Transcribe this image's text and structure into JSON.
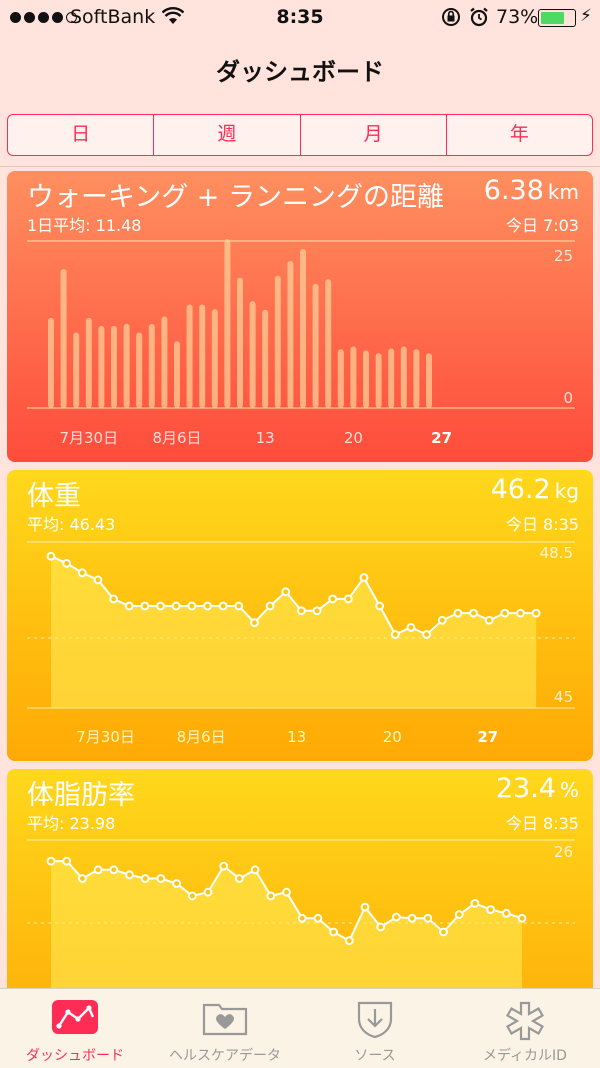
{
  "status_bar": {
    "carrier": "SoftBank",
    "time": "8:35",
    "battery_pct": "73%",
    "battery_level": 0.73
  },
  "nav": {
    "title": "ダッシュボード"
  },
  "segments": [
    {
      "label": "日",
      "active": false
    },
    {
      "label": "週",
      "active": false
    },
    {
      "label": "月",
      "active": true
    },
    {
      "label": "年",
      "active": false
    }
  ],
  "cards": {
    "distance": {
      "title": "ウォーキング + ランニングの距離",
      "value": "6.38",
      "unit": "km",
      "sub": "1日平均: 11.48",
      "time": "今日 7:03",
      "color": "#ff6a45"
    },
    "weight": {
      "title": "体重",
      "value": "46.2",
      "unit": "kg",
      "sub": "平均: 46.43",
      "time": "今日 8:35",
      "color": "#ffc20f"
    },
    "bodyfat": {
      "title": "体脂肪率",
      "value": "23.4",
      "unit": "%",
      "sub": "平均: 23.98",
      "time": "今日 8:35",
      "color": "#ffc814"
    }
  },
  "chart_data": [
    {
      "type": "bar",
      "name": "distance",
      "x": [
        1,
        2,
        3,
        4,
        5,
        6,
        7,
        8,
        9,
        10,
        11,
        12,
        13,
        14,
        15,
        16,
        17,
        18,
        19,
        20,
        21,
        22,
        23,
        24,
        25,
        26,
        27,
        28,
        29,
        30,
        31
      ],
      "values": [
        13.5,
        20.8,
        11.3,
        13.5,
        12.3,
        12.3,
        12.6,
        11.3,
        12.6,
        13.7,
        10.0,
        15.5,
        15.5,
        14.8,
        25.3,
        19.5,
        16.0,
        14.7,
        19.8,
        22.0,
        23.8,
        18.6,
        19.3,
        8.8,
        9.2,
        8.6,
        8.2,
        8.9,
        9.2,
        8.8,
        8.2
      ],
      "ylim": [
        0,
        25
      ],
      "ytick_labels": [
        "25",
        "0"
      ],
      "xtick_labels": [
        "7月30日",
        "8月6日",
        "13",
        "20",
        "27"
      ],
      "xtick_positions": [
        4,
        11,
        18,
        25,
        32
      ]
    },
    {
      "type": "line",
      "name": "weight",
      "x": [
        1,
        2,
        3,
        4,
        5,
        6,
        7,
        8,
        9,
        10,
        11,
        12,
        13,
        14,
        15,
        16,
        17,
        18,
        19,
        20,
        21,
        22,
        23,
        24,
        25,
        26,
        27,
        28,
        29,
        30,
        31,
        32
      ],
      "values": [
        48.2,
        48.05,
        47.85,
        47.7,
        47.3,
        47.15,
        47.15,
        47.15,
        47.15,
        47.15,
        47.15,
        47.15,
        47.15,
        46.8,
        47.15,
        47.45,
        47.05,
        47.05,
        47.3,
        47.3,
        47.75,
        47.15,
        46.55,
        46.7,
        46.55,
        46.85,
        47.0,
        47.0,
        46.85,
        47.0,
        47.0,
        47.0
      ],
      "ylim": [
        45,
        48.5
      ],
      "ytick_labels": [
        "48.5",
        "45"
      ],
      "xtick_labels": [
        "7月30日",
        "8月6日",
        "13",
        "20",
        "27"
      ],
      "xtick_positions": [
        5,
        12,
        19,
        26,
        33
      ]
    },
    {
      "type": "line",
      "name": "bodyfat",
      "x": [
        1,
        2,
        3,
        4,
        5,
        6,
        7,
        8,
        9,
        10,
        11,
        12,
        13,
        14,
        15,
        16,
        17,
        18,
        19,
        20,
        21,
        22,
        23,
        24,
        25,
        26,
        27,
        28,
        29,
        30,
        31
      ],
      "values": [
        25.15,
        25.15,
        24.45,
        24.8,
        24.8,
        24.6,
        24.45,
        24.45,
        24.25,
        23.75,
        23.9,
        24.95,
        24.45,
        24.8,
        23.75,
        23.9,
        22.85,
        22.85,
        22.3,
        21.95,
        23.3,
        22.5,
        22.9,
        22.85,
        22.85,
        22.3,
        23.0,
        23.45,
        23.2,
        23.05,
        22.85
      ],
      "ylim": [
        19,
        26
      ],
      "ytick_labels": [
        "26"
      ]
    }
  ],
  "tabbar": [
    {
      "label": "ダッシュボード",
      "icon": "dashboard-icon",
      "active": true
    },
    {
      "label": "ヘルスケアデータ",
      "icon": "health-data-folder-icon",
      "active": false
    },
    {
      "label": "ソース",
      "icon": "sources-download-icon",
      "active": false
    },
    {
      "label": "メディカルID",
      "icon": "medical-id-icon",
      "active": false
    }
  ]
}
